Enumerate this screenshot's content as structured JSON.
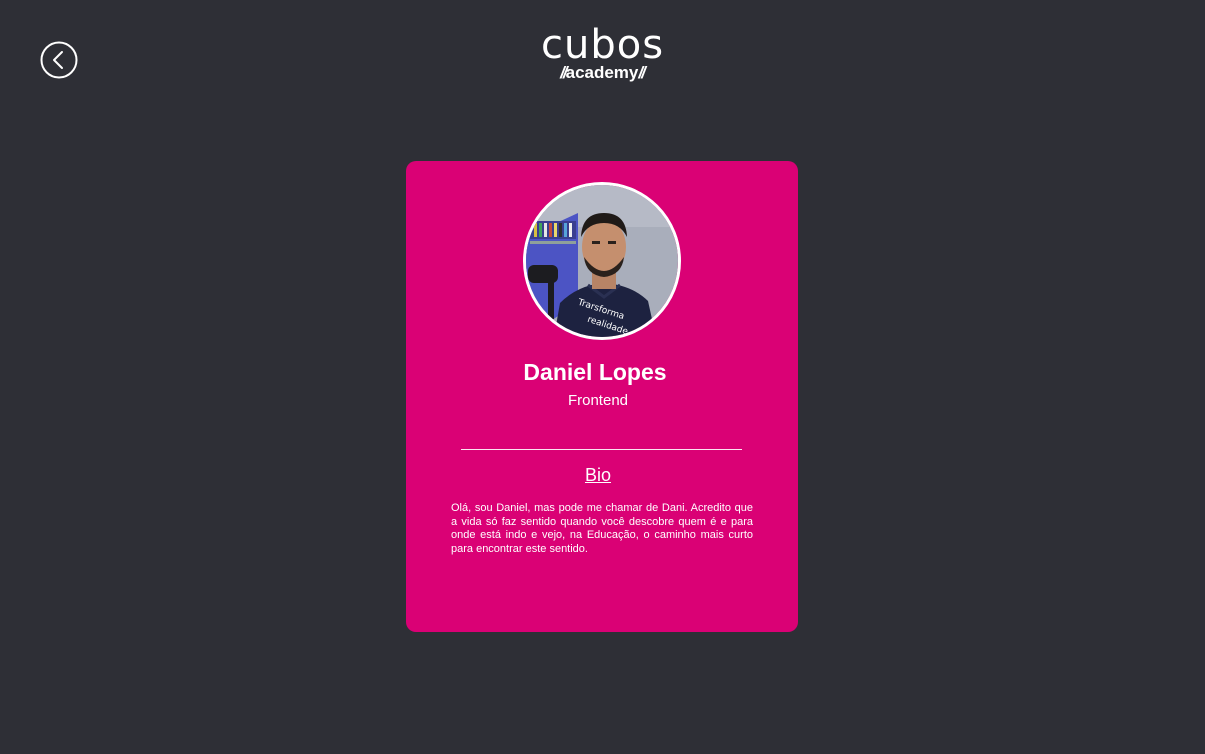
{
  "header": {
    "back_icon": "chevron-left-circle-icon",
    "logo": {
      "word": "cubos",
      "sub_prefix": "//",
      "sub_text": "academy",
      "sub_suffix": "//"
    }
  },
  "profile": {
    "avatar_icon": "profile-photo",
    "name": "Daniel Lopes",
    "role": "Frontend",
    "bio_title": "Bio",
    "bio_text": "Olá, sou Daniel, mas pode me chamar de Dani. Acredito que a vida só faz sentido quando você descobre quem é e para onde está indo e vejo, na Educação, o caminho mais curto para encontrar este sentido."
  },
  "colors": {
    "background": "#2e2f36",
    "card": "#da0175",
    "text": "#ffffff"
  }
}
